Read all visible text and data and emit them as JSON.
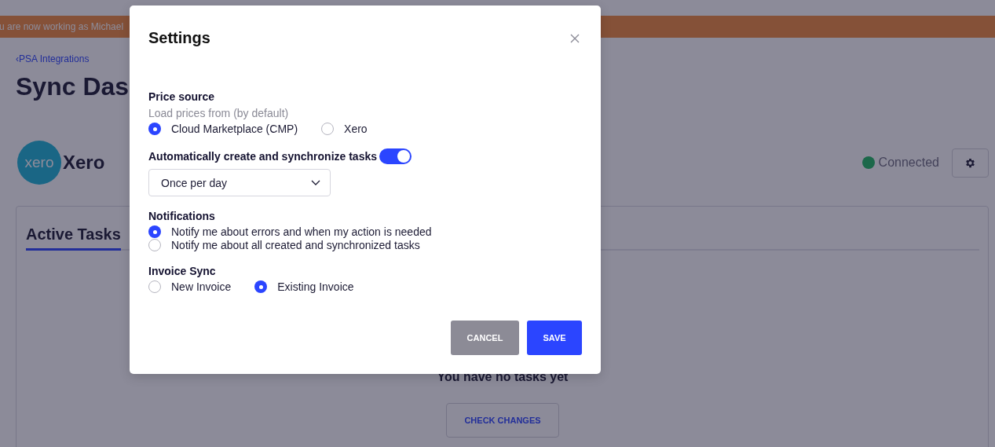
{
  "banner": {
    "text": "u are now working as Michael"
  },
  "breadcrumb": {
    "text": "‹PSA Integrations"
  },
  "page_title": "Sync Das",
  "integration": {
    "name": "Xero",
    "logo_text": "xero",
    "status": "Connected"
  },
  "tabs": [
    {
      "label": "Active Tasks",
      "selected": true
    }
  ],
  "empty_state": {
    "message": "You have no tasks yet",
    "button": "CHECK CHANGES"
  },
  "dialog": {
    "title": "Settings",
    "sections": [
      {
        "kind": "inline",
        "title": "Price source",
        "hint": "Load prices from (by default)",
        "options": [
          {
            "label": "Cloud Marketplace (CMP)",
            "selected": true
          },
          {
            "label": "Xero",
            "selected": false
          }
        ]
      },
      {
        "kind": "toggle",
        "title": "Automatically create and synchronize tasks",
        "on": true,
        "select": {
          "value": "Once per day"
        }
      },
      {
        "kind": "stacked",
        "title": "Notifications",
        "options": [
          {
            "label": "Notify me about errors and when my action is needed",
            "selected": true
          },
          {
            "label": "Notify me about all created and synchronized tasks",
            "selected": false
          }
        ]
      },
      {
        "kind": "inline",
        "title": "Invoice Sync",
        "options": [
          {
            "label": "New Invoice",
            "selected": false
          },
          {
            "label": "Existing Invoice",
            "selected": true
          }
        ]
      }
    ],
    "buttons": [
      {
        "label": "CANCEL",
        "kind": "secondary"
      },
      {
        "label": "SAVE",
        "kind": "primary"
      }
    ]
  }
}
